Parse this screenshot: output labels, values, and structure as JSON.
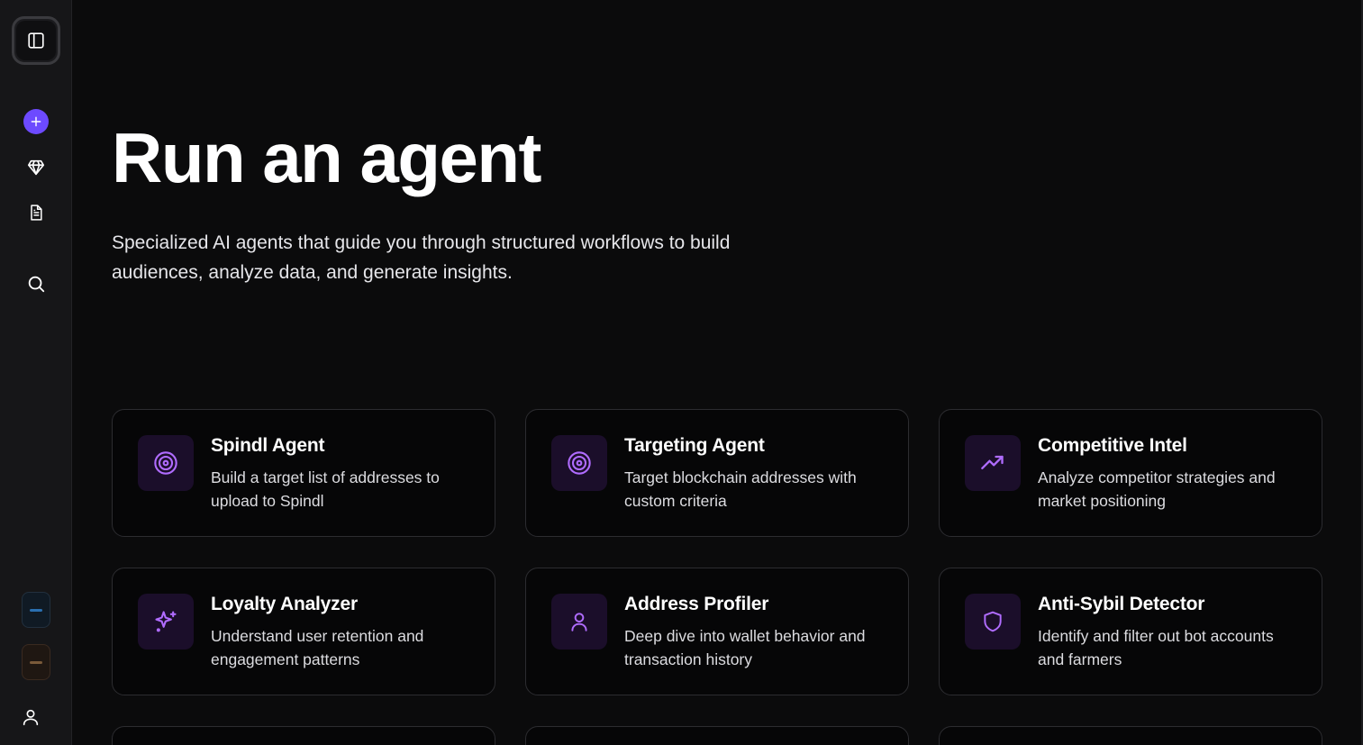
{
  "sidebar": {
    "items": [
      {
        "icon": "sidebar-toggle-icon"
      },
      {
        "icon": "plus-icon"
      },
      {
        "icon": "gem-icon"
      },
      {
        "icon": "document-icon"
      },
      {
        "icon": "search-icon"
      },
      {
        "icon": "workspace-icon"
      },
      {
        "icon": "workspace-icon"
      },
      {
        "icon": "user-icon"
      }
    ],
    "accent": "#6d4aff"
  },
  "main": {
    "title": "Run an agent",
    "subtitle": "Specialized AI agents that guide you through structured workflows to build audiences, analyze data, and generate insights.",
    "agents": [
      {
        "title": "Spindl Agent",
        "description": "Build a target list of addresses to upload to Spindl",
        "icon": "target-icon"
      },
      {
        "title": "Targeting Agent",
        "description": "Target blockchain addresses with custom criteria",
        "icon": "target-icon"
      },
      {
        "title": "Competitive Intel",
        "description": "Analyze competitor strategies and market positioning",
        "icon": "trending-up-icon"
      },
      {
        "title": "Loyalty Analyzer",
        "description": "Understand user retention and engagement patterns",
        "icon": "sparkles-icon"
      },
      {
        "title": "Address Profiler",
        "description": "Deep dive into wallet behavior and transaction history",
        "icon": "user-icon"
      },
      {
        "title": "Anti-Sybil Detector",
        "description": "Identify and filter out bot accounts and farmers",
        "icon": "shield-icon"
      }
    ],
    "icon_color": "#b06cff",
    "icon_bg": "#1b0e2a"
  }
}
